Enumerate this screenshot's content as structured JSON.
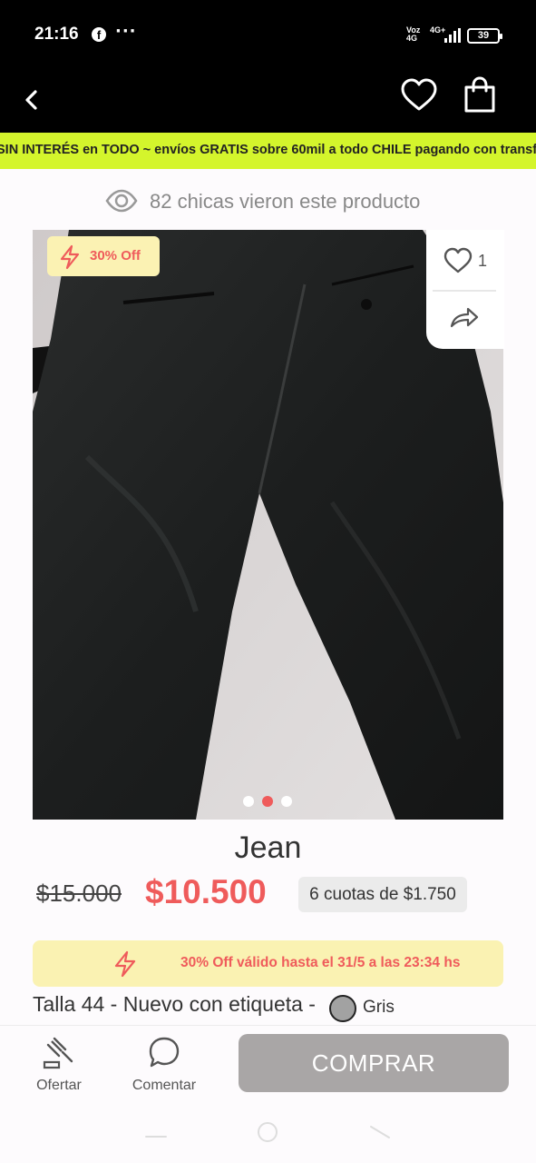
{
  "status_bar": {
    "time": "21:16",
    "facebook_icon": "f",
    "more": "···",
    "network_left": [
      "Voz",
      "4G"
    ],
    "network_right": "4G+",
    "battery": "39"
  },
  "app_bar": {
    "back_icon": "chevron-left-icon",
    "favorite_icon": "heart-icon",
    "cart_icon": "shopping-bag-icon"
  },
  "announcement": {
    "text": "SIN INTERÉS en TODO ~ envíos GRATIS sobre 60mil a todo CHILE pagando con transf",
    "background": "#d4f52c"
  },
  "views": {
    "text": "82 chicas vieron este producto",
    "icon": "eye-icon"
  },
  "product": {
    "discount_badge": "30% Off",
    "likes": "1",
    "carousel": {
      "count": 3,
      "active": 2
    },
    "title": "Jean",
    "old_price": "$15.000",
    "price": "$10.500",
    "installments": "6 cuotas de $1.750",
    "promo": "30% Off válido hasta el 31/5 a las 23:34 hs",
    "details": "Talla 44 - Nuevo con etiqueta -",
    "color_name": "Gris",
    "color_swatch": "#a2a2a2"
  },
  "actions": {
    "offer": "Ofertar",
    "comment": "Comentar",
    "buy": "COMPRAR"
  },
  "colors": {
    "accent": "#ef5b5b",
    "promo_bg": "#faf2b2",
    "buy_disabled": "#a9a6a6"
  }
}
